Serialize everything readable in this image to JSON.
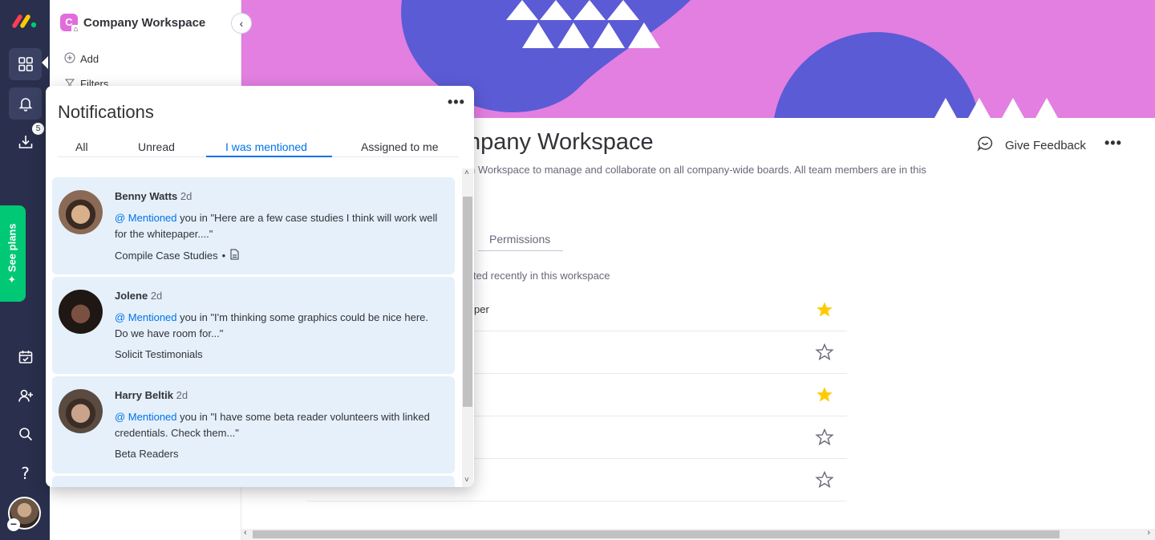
{
  "rail": {
    "see_plans_label": "See plans",
    "inbox_badge": "5",
    "icons": [
      "monday-logo-icon",
      "workspace-grid-icon",
      "bell-icon",
      "inbox-download-icon",
      "calendar-icon",
      "invite-user-icon",
      "search-icon",
      "help-icon",
      "avatar"
    ]
  },
  "workspace_panel": {
    "logo_letter": "C",
    "title": "Company Workspace",
    "add_label": "Add",
    "filters_label": "Filters"
  },
  "main": {
    "title_partial": "mpany Workspace",
    "description_partial": "n Workspace to manage and collaborate on all company-wide boards. All team members are in this",
    "feedback_label": "Give Feedback",
    "permissions_tab": "Permissions",
    "recent_text_partial": "ted recently in this workspace",
    "boards": [
      {
        "name": "per",
        "starred": true
      },
      {
        "name": "",
        "starred": false
      },
      {
        "name": "",
        "starred": true
      },
      {
        "name": "",
        "starred": false
      },
      {
        "name": "",
        "starred": false
      }
    ]
  },
  "notifications": {
    "title": "Notifications",
    "tabs": [
      {
        "label": "All",
        "active": false
      },
      {
        "label": "Unread",
        "active": false
      },
      {
        "label": "I was mentioned",
        "active": true
      },
      {
        "label": "Assigned to me",
        "active": false
      }
    ],
    "items": [
      {
        "author": "Benny Watts",
        "time": "2d",
        "mention_label": "@ Mentioned",
        "message": " you in \"Here are a few case studies I think will work well for the whitepaper....\"",
        "board": "Compile Case Studies",
        "has_doc_icon": true
      },
      {
        "author": "Jolene",
        "time": "2d",
        "mention_label": "@ Mentioned",
        "message": " you in \"I'm thinking some graphics could be nice here. Do we have room for...\"",
        "board": "Solicit Testimonials",
        "has_doc_icon": false
      },
      {
        "author": "Harry Beltik",
        "time": "2d",
        "mention_label": "@ Mentioned",
        "message": " you in \"I have some beta reader volunteers with linked credentials. Check them...\"",
        "board": "Beta Readers",
        "has_doc_icon": false
      }
    ]
  },
  "colors": {
    "rail_bg": "#292f4c",
    "banner_pink": "#e27fe0",
    "banner_blue": "#5b5bd6",
    "accent_blue": "#0073ea",
    "card_bg": "#e5f0fb",
    "star_yellow": "#ffcb00",
    "see_plans_green": "#00c875"
  }
}
